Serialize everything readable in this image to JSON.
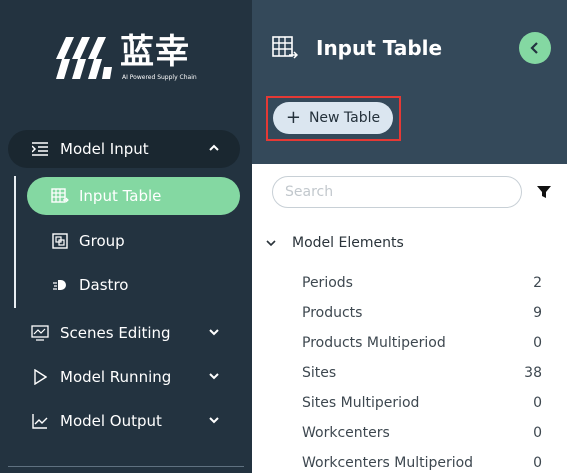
{
  "brand": {
    "name": "蓝幸",
    "tagline": "AI Powered Supply Chain"
  },
  "sidebar": {
    "model_input": {
      "label": "Model Input",
      "icon": "indent-list-icon"
    },
    "sub_items": [
      {
        "label": "Input Table",
        "icon": "table-icon",
        "active": true
      },
      {
        "label": "Group",
        "icon": "group-icon"
      },
      {
        "label": "Dastro",
        "icon": "dastro-icon"
      }
    ],
    "scenes_editing": {
      "label": "Scenes Editing",
      "icon": "monitor-chart-icon"
    },
    "model_running": {
      "label": "Model Running",
      "icon": "play-icon"
    },
    "model_output": {
      "label": "Model Output",
      "icon": "line-chart-icon"
    }
  },
  "header": {
    "title": "Input Table",
    "new_table_label": "New Table"
  },
  "search": {
    "placeholder": "Search"
  },
  "tree": {
    "group_label": "Model Elements",
    "rows": [
      {
        "label": "Periods",
        "count": "2"
      },
      {
        "label": "Products",
        "count": "9"
      },
      {
        "label": "Products Multiperiod",
        "count": "0"
      },
      {
        "label": "Sites",
        "count": "38"
      },
      {
        "label": "Sites Multiperiod",
        "count": "0"
      },
      {
        "label": "Workcenters",
        "count": "0"
      },
      {
        "label": "Workcenters Multiperiod",
        "count": "0"
      }
    ]
  },
  "colors": {
    "sidebar_bg": "#233340",
    "header_bg": "#34495a",
    "accent_green": "#84d8a2",
    "highlight_red": "#e53935",
    "button_bg": "#dbe6f0"
  }
}
